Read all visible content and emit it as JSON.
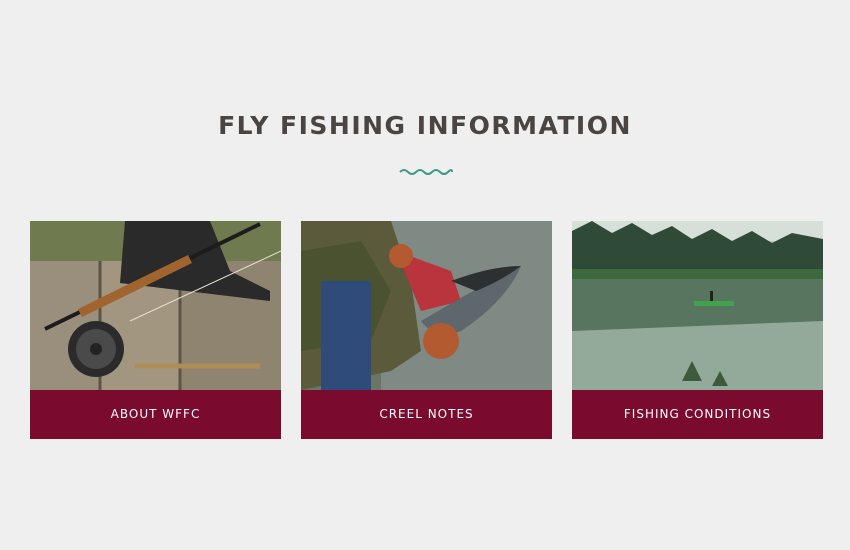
{
  "section": {
    "title": "FLY FISHING INFORMATION"
  },
  "colors": {
    "accent_wave": "#3e9a8c",
    "card_label_bg": "#7a0a2e",
    "page_bg": "#efefef"
  },
  "cards": [
    {
      "label": "ABOUT WFFC",
      "image": "fly-rod-and-reel-photo"
    },
    {
      "label": "CREEL NOTES",
      "image": "angler-holding-salmon-photo"
    },
    {
      "label": "FISHING CONDITIONS",
      "image": "lake-with-boat-photo"
    }
  ]
}
